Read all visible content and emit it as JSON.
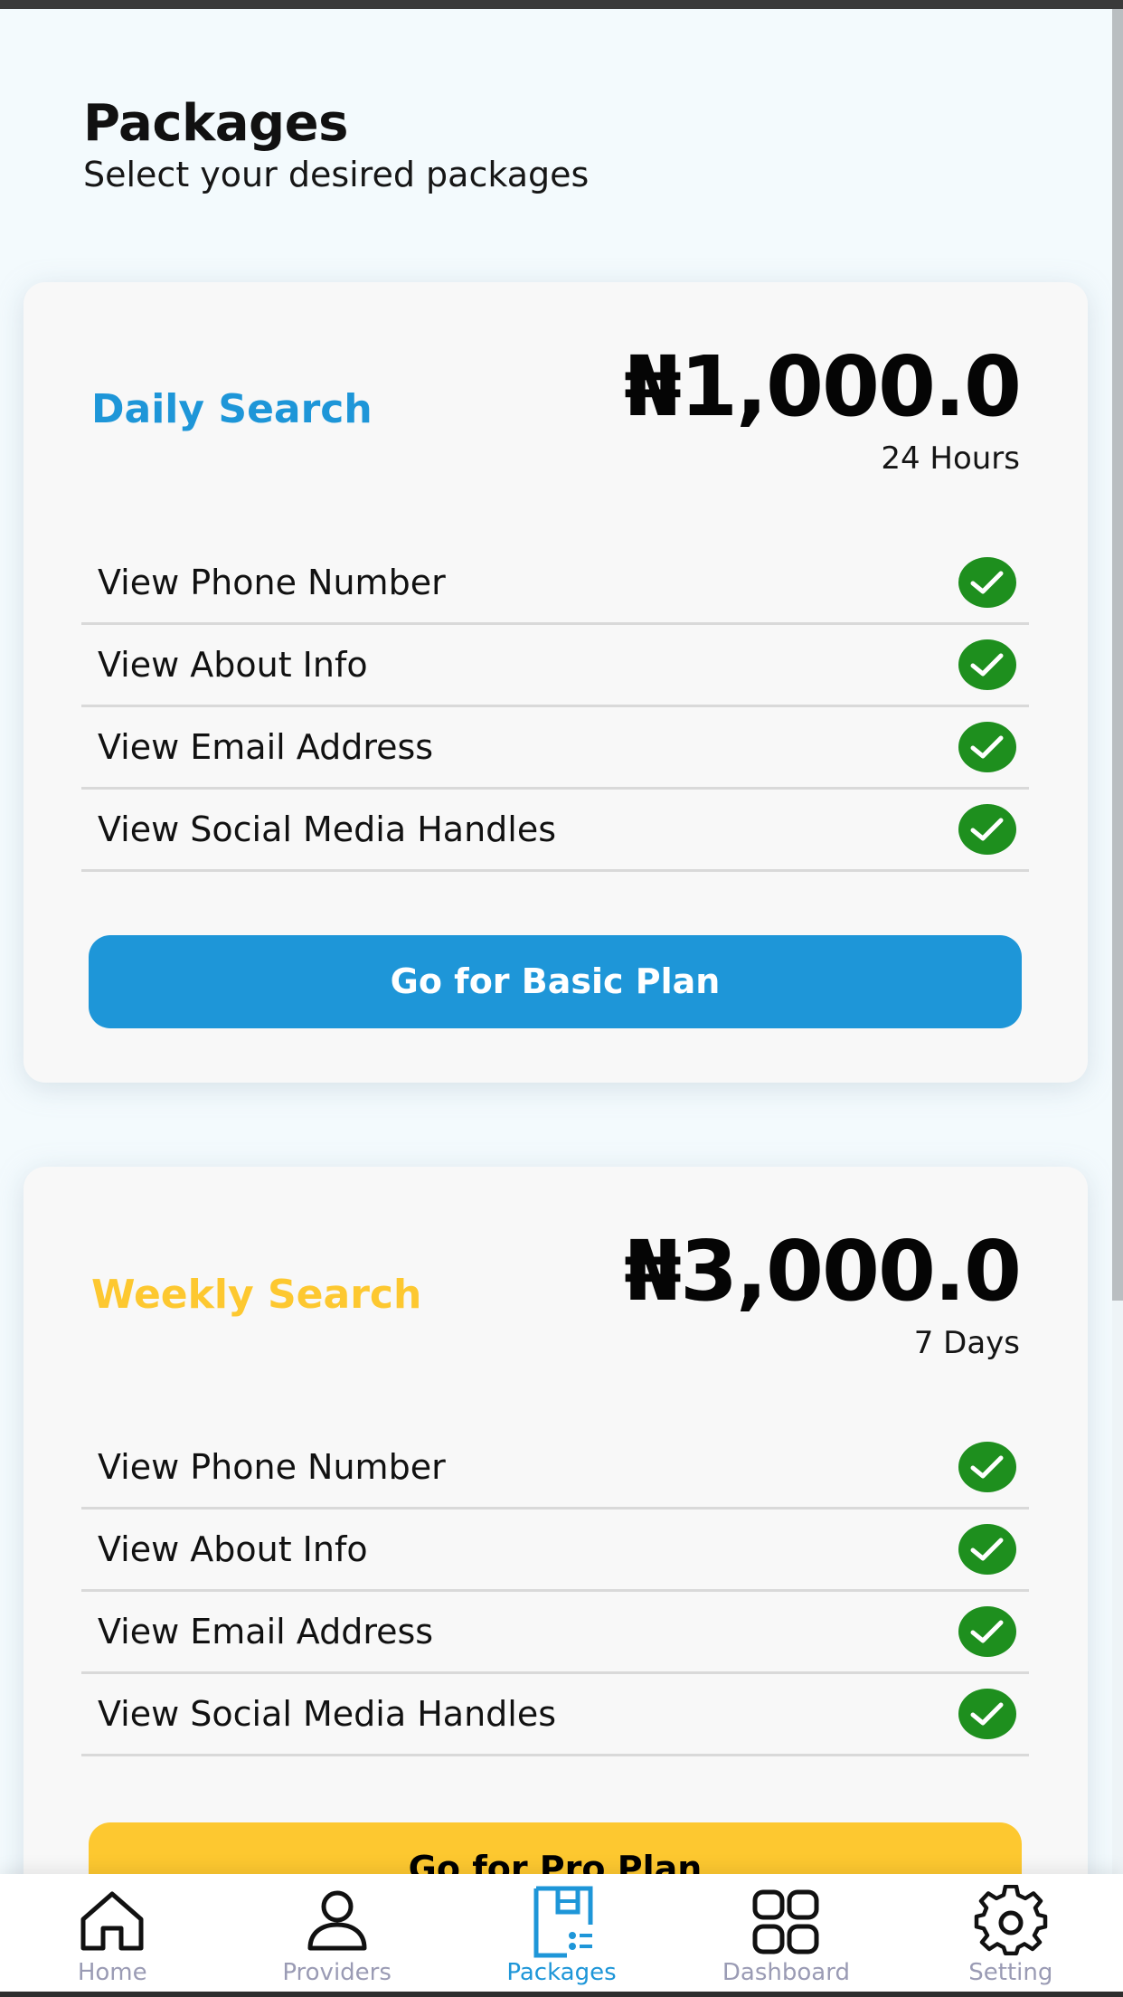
{
  "header": {
    "title": "Packages",
    "subtitle": "Select your desired packages"
  },
  "colors": {
    "primary_blue": "#1E96D8",
    "accent_yellow": "#FDC830",
    "check_green": "#1E8F1E",
    "nav_inactive": "#9A9BB4"
  },
  "packages": [
    {
      "name": "Daily Search",
      "name_color": "#1E96D8",
      "price": "₦1,000.0",
      "duration": "24 Hours",
      "features": [
        {
          "label": "View Phone Number",
          "icon": "check-circle-icon"
        },
        {
          "label": "View About Info",
          "icon": "check-circle-icon"
        },
        {
          "label": "View Email Address",
          "icon": "check-circle-icon"
        },
        {
          "label": "View Social Media Handles",
          "icon": "check-circle-icon"
        }
      ],
      "button_label": "Go for Basic Plan",
      "button_color": "#1E96D8",
      "button_text_color": "#FFFFFF"
    },
    {
      "name": "Weekly Search",
      "name_color": "#FDC830",
      "price": "₦3,000.0",
      "duration": "7 Days",
      "features": [
        {
          "label": "View Phone Number",
          "icon": "check-circle-icon"
        },
        {
          "label": "View About Info",
          "icon": "check-circle-icon"
        },
        {
          "label": "View Email Address",
          "icon": "check-circle-icon"
        },
        {
          "label": "View Social Media Handles",
          "icon": "check-circle-icon"
        }
      ],
      "button_label": "Go for Pro Plan",
      "button_color": "#FDC830",
      "button_text_color": "#000000"
    }
  ],
  "bottom_nav": {
    "items": [
      {
        "label": "Home",
        "icon": "home-icon",
        "active": false
      },
      {
        "label": "Providers",
        "icon": "user-icon",
        "active": false
      },
      {
        "label": "Packages",
        "icon": "package-icon",
        "active": true
      },
      {
        "label": "Dashboard",
        "icon": "grid-icon",
        "active": false
      },
      {
        "label": "Setting",
        "icon": "gear-icon",
        "active": false
      }
    ]
  }
}
